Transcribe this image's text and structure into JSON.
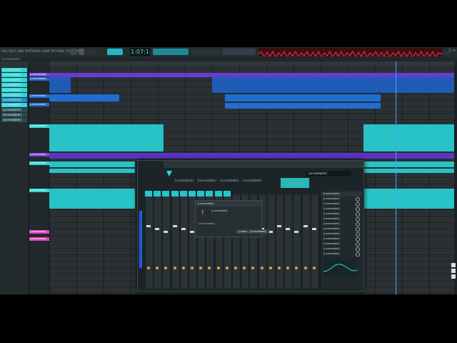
{
  "toolbar": {
    "menu": "FILE EDIT ADD PATTERNS VIEW OPTIONS TOOLS HELP",
    "time": "1:07:1",
    "hint": "[unreadable]"
  },
  "sidebar": {
    "items": [
      {
        "label": "[unreadable]",
        "color": "#2dd6d6"
      },
      {
        "label": "[unreadable]",
        "color": "#2dd6d6"
      },
      {
        "label": "[unreadable]",
        "color": "#2dd6d6"
      },
      {
        "label": "[unreadable]",
        "color": "#2dd6d6"
      },
      {
        "label": "[unreadable]",
        "color": "#2dd6d6"
      },
      {
        "label": "[unreadable]",
        "color": "#2dd6d6"
      },
      {
        "label": "[unreadable]",
        "color": "#1f8fc6"
      },
      {
        "label": "[unreadable]",
        "color": "#2dd6d6"
      },
      {
        "label": "[unreadable]",
        "color": "#2a4a55"
      },
      {
        "label": "[unreadable]",
        "color": "#2a4a55"
      },
      {
        "label": "[unreadable]",
        "color": "#2a4a55"
      }
    ]
  },
  "tracks": [
    {
      "label": "[unreadable]",
      "color": "#7b3fe4"
    },
    {
      "label": "[unreadable]",
      "color": "#1f66c9"
    },
    {
      "label": "[unreadable]",
      "color": "#1f66c9"
    },
    {
      "label": "[unreadable]",
      "color": "#1f66c9"
    },
    {
      "label": "[unreadable]",
      "color": "#2dd6d6"
    },
    {
      "label": "[unreadable]",
      "color": "#7b3fe4"
    },
    {
      "label": "[unreadable]",
      "color": "#2dd6d6"
    },
    {
      "label": "[unreadable]",
      "color": "#2dd6d6"
    },
    {
      "label": "[unreadable]",
      "color": "#e33fbf"
    },
    {
      "label": "[unreadable]",
      "color": "#e33fbf"
    }
  ],
  "plugin": {
    "tabs": [
      "[unreadable]",
      "[unreadable]",
      "[unreadable]",
      "[unreadable]"
    ],
    "preset": "[unreadable]"
  },
  "dialog": {
    "title": "[unreadable]",
    "message": "[unreadable]",
    "option": "[unreadable]",
    "ok": "[unreadable]",
    "cancel": "[unreadable]"
  },
  "fx_panel": {
    "header": "[unreadable]",
    "items": [
      "[unreadable]",
      "[unreadable]",
      "[unreadable]",
      "[unreadable]",
      "[unreadable]",
      "[unreadable]",
      "[unreadable]",
      "[unreadable]",
      "[unreadable]",
      "[unreadable]",
      "[unreadable]",
      "[unreadable]"
    ]
  },
  "colors": {
    "accent": "#2dd6d6",
    "purple": "#7b3fe4",
    "blue": "#1f66c9",
    "magenta": "#e33fbf",
    "waveform": "#c8292f"
  }
}
